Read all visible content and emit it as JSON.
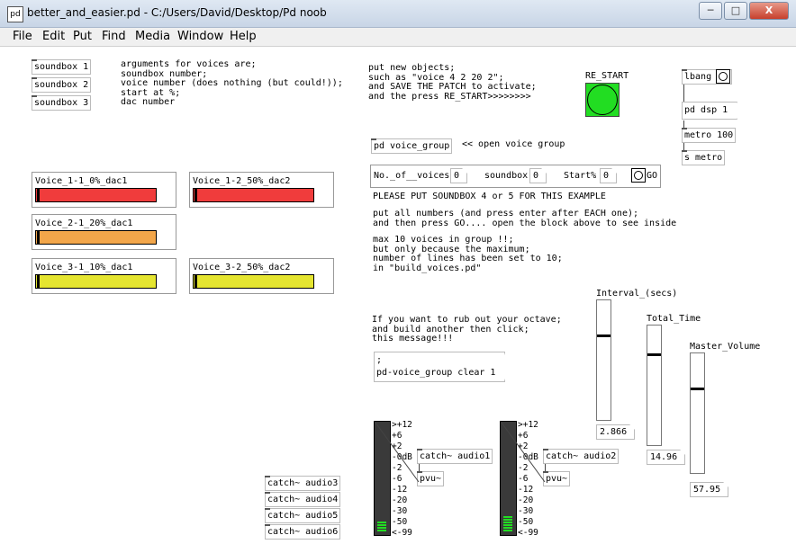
{
  "window": {
    "title": "better_and_easier.pd  - C:/Users/David/Desktop/Pd noob",
    "icon": "pd-file-icon",
    "buttons": [
      "─",
      "□",
      "X"
    ]
  },
  "menu": [
    "File",
    "Edit",
    "Put",
    "Find",
    "Media",
    "Window",
    "Help"
  ],
  "left_objects": [
    "soundbox 1",
    "soundbox 2",
    "soundbox 3"
  ],
  "args_comment": "arguments for voices are;\nsoundbox number;\nvoice number (does nothing (but could!));\nstart at %;\ndac number",
  "voices": [
    {
      "label": "Voice_1-1_0%_dac1",
      "color": "#f03c3c",
      "level": 0.01
    },
    {
      "label": "Voice_1-2_50%_dac2",
      "color": "#f03c3c",
      "level": 0.01
    },
    {
      "label": "Voice_2-1_20%_dac1",
      "color": "#f2a64a",
      "level": 0.01
    },
    {
      "label": "Voice_3-1_10%_dac1",
      "color": "#e5e530",
      "level": 0.01
    },
    {
      "label": "Voice_3-2_50%_dac2",
      "color": "#e5e530",
      "level": 0.01
    }
  ],
  "instructions": "put new objects;\nsuch as \"voice 4 2 20 2\";\nand SAVE THE PATCH to activate;\nand the press RE_START>>>>>>>>",
  "restart": {
    "label": "RE_START",
    "color": "#22dd22"
  },
  "loadbang_group": [
    "lbang",
    "pd dsp 1",
    "metro 100",
    "s metro"
  ],
  "voice_group": {
    "object": "pd voice_group",
    "comment": "<< open voice group"
  },
  "controls": {
    "voices_label": "No._of__voices",
    "voices_value": "0",
    "soundbox_label": "soundbox",
    "soundbox_value": "0",
    "start_label": "Start%",
    "start_value": "0",
    "go_label": "GO"
  },
  "notes": {
    "please": "PLEASE PUT SOUNDBOX 4 or 5 FOR THIS EXAMPLE",
    "put_numbers": "put all numbers (and press enter after EACH one);\nand then press GO.... open the block above to see inside",
    "max_voices": "max 10 voices in group !!;\nbut only because the maximum;\nnumber of lines has been set to 10;\nin \"build_voices.pd\"",
    "rub_out": "If you want to rub out your octave;\nand build another then click;\nthis message!!!"
  },
  "clear_message": ";\npd-voice_group clear 1",
  "sliders": [
    {
      "label": "Interval_(secs)",
      "value_text": "2.866",
      "level": 0.71
    },
    {
      "label": "Total_Time",
      "value_text": "14.96",
      "level": 0.76
    },
    {
      "label": "Master_Volume",
      "value_text": "57.95",
      "level": 0.71
    }
  ],
  "catch_objects": [
    "catch~ audio3",
    "catch~ audio4",
    "catch~ audio5",
    "catch~ audio6"
  ],
  "meters": [
    {
      "catch": "catch~ audio1",
      "pvu": "pvu~",
      "scale": ">+12\n+6\n+2\n-0dB\n-2\n-6\n-12\n-20\n-30\n-50\n<-99",
      "level_db": -50
    },
    {
      "catch": "catch~ audio2",
      "pvu": "pvu~",
      "scale": ">+12\n+6\n+2\n-0dB\n-2\n-6\n-12\n-20\n-30\n-50\n<-99",
      "level_db": -30
    }
  ],
  "colors": {
    "accent": "#22dd22",
    "red": "#f03c3c",
    "orange": "#f2a64a",
    "yellow": "#e5e530"
  }
}
